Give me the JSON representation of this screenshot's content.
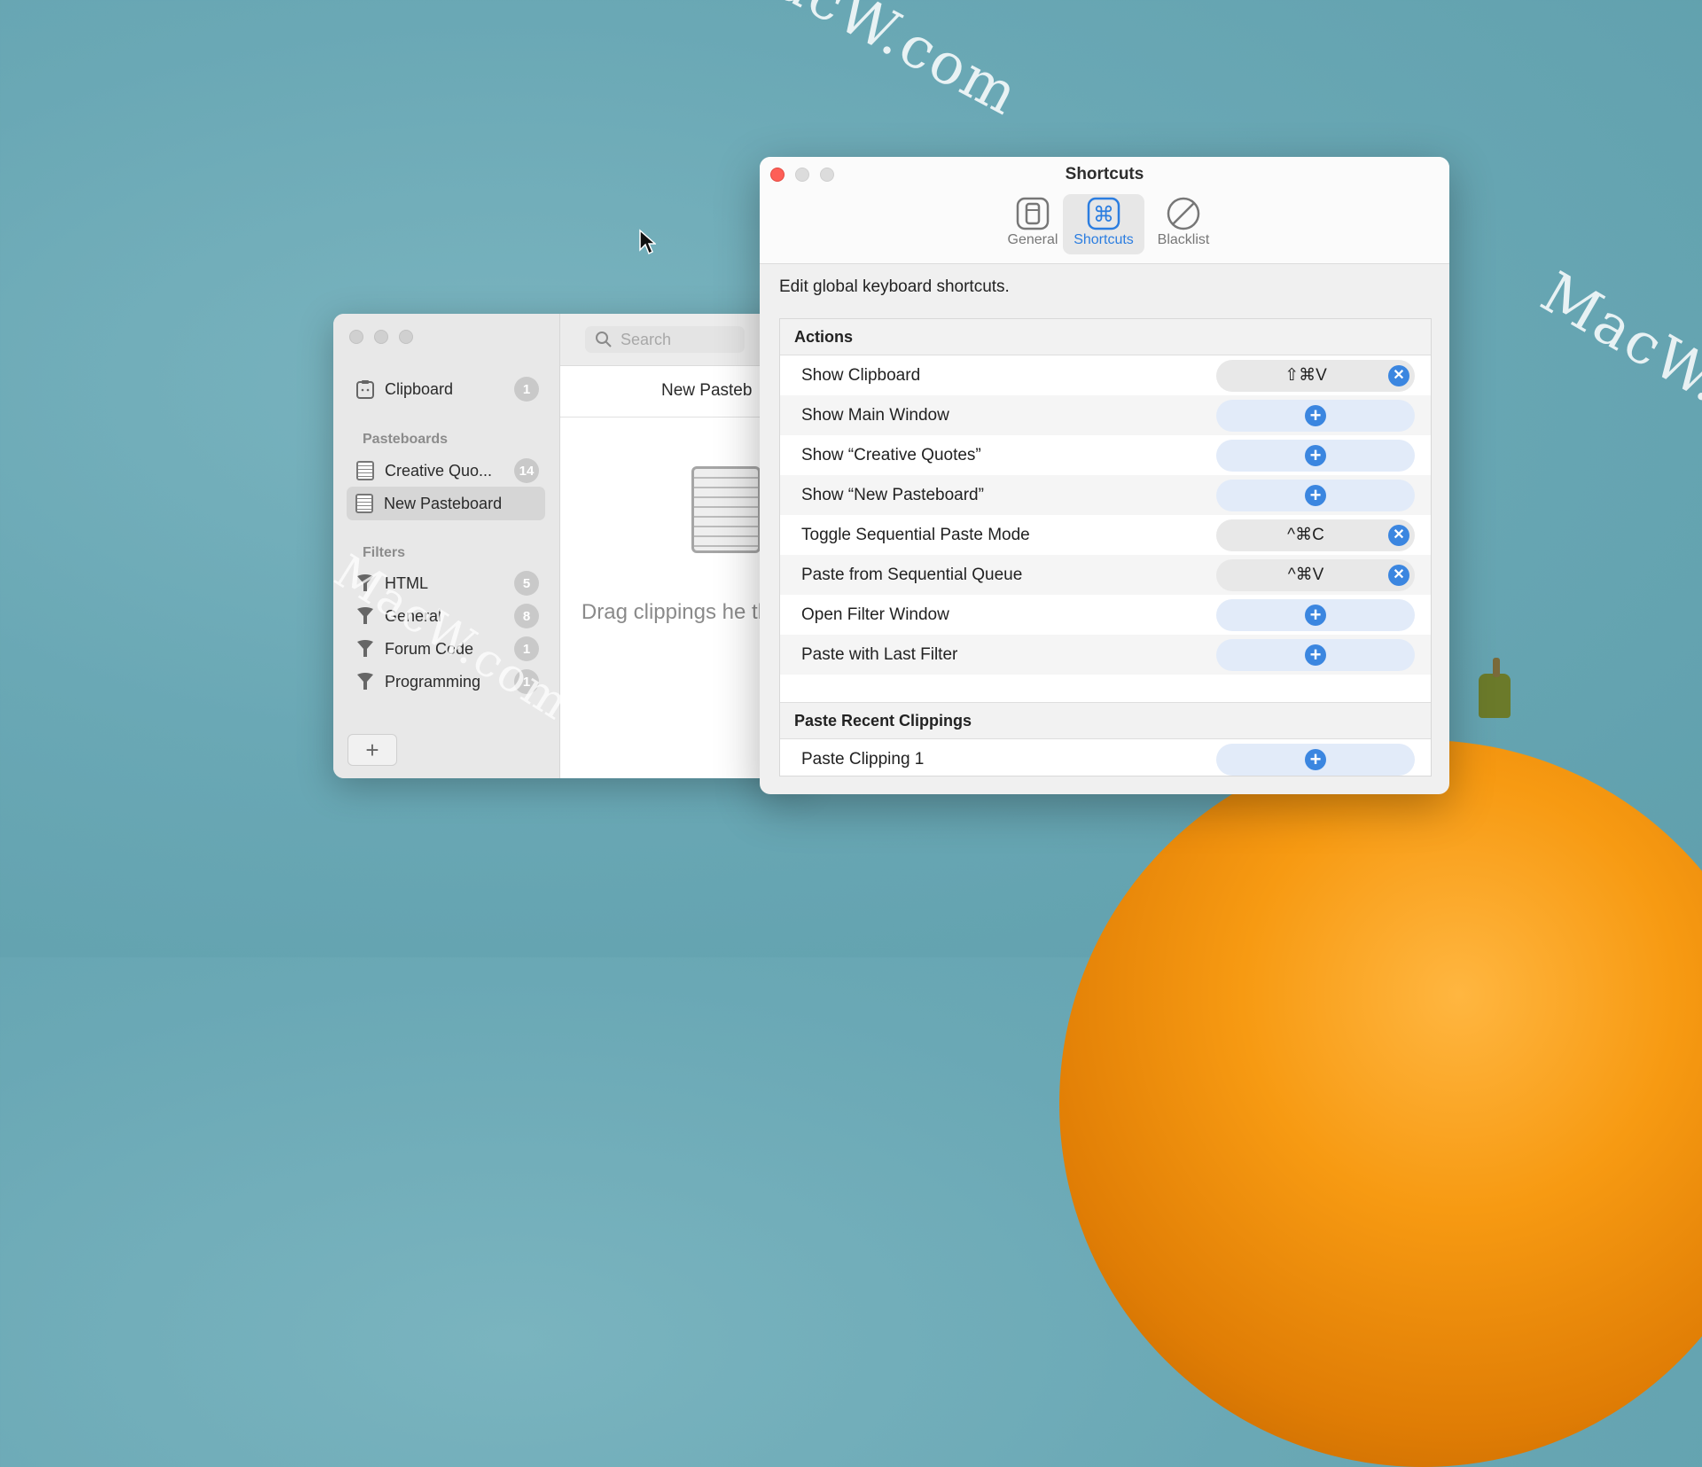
{
  "watermark": "MacW.com",
  "back_window": {
    "sidebar": {
      "clipboard": {
        "label": "Clipboard",
        "count": "1"
      },
      "pasteboards_header": "Pasteboards",
      "pasteboards": [
        {
          "label": "Creative Quo...",
          "count": "14"
        },
        {
          "label": "New Pasteboard",
          "count": ""
        }
      ],
      "filters_header": "Filters",
      "filters": [
        {
          "label": "HTML",
          "count": "5"
        },
        {
          "label": "General",
          "count": "8"
        },
        {
          "label": "Forum Code",
          "count": "1"
        },
        {
          "label": "Programming",
          "count": "1"
        }
      ],
      "add_label": "+"
    },
    "search_placeholder": "Search",
    "pasteboard_title": "New Pasteb",
    "drop_text": "Drag clippings he them."
  },
  "prefs": {
    "title": "Shortcuts",
    "tabs": [
      {
        "label": "General",
        "icon": "general-icon"
      },
      {
        "label": "Shortcuts",
        "icon": "command-icon"
      },
      {
        "label": "Blacklist",
        "icon": "blacklist-icon"
      }
    ],
    "intro": "Edit global keyboard shortcuts.",
    "sections": [
      {
        "header": "Actions"
      },
      {
        "header": "Paste Recent Clippings"
      }
    ],
    "actions": [
      {
        "label": "Show Clipboard",
        "keys": "⇧⌘V"
      },
      {
        "label": "Show Main Window",
        "keys": ""
      },
      {
        "label": "Show “Creative Quotes”",
        "keys": ""
      },
      {
        "label": "Show “New Pasteboard”",
        "keys": ""
      },
      {
        "label": "Toggle Sequential Paste Mode",
        "keys": "^⌘C"
      },
      {
        "label": "Paste from Sequential Queue",
        "keys": "^⌘V"
      },
      {
        "label": "Open Filter Window",
        "keys": ""
      },
      {
        "label": "Paste with Last Filter",
        "keys": ""
      }
    ],
    "recent": [
      {
        "label": "Paste Clipping 1",
        "keys": ""
      }
    ],
    "accent_color": "#3b86e0"
  }
}
